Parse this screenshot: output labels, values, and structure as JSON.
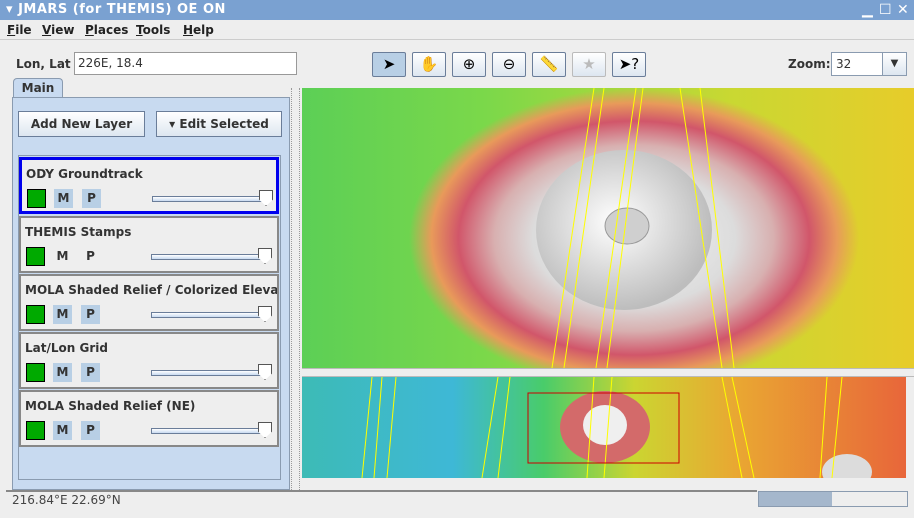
{
  "window": {
    "title": "JMARS (for THEMIS) OE ON",
    "controls": [
      "minimize",
      "maximize",
      "close"
    ]
  },
  "menu": [
    "File",
    "View",
    "Places",
    "Tools",
    "Help"
  ],
  "location": {
    "label": "Lon, Lat",
    "value": "226E, 18.4"
  },
  "toolbar": {
    "tools": [
      {
        "name": "select-arrow-icon",
        "glyph": "➤",
        "selected": true,
        "enabled": true
      },
      {
        "name": "pan-hand-icon",
        "glyph": "✋",
        "selected": false,
        "enabled": true
      },
      {
        "name": "zoom-in-icon",
        "glyph": "⊕",
        "selected": false,
        "enabled": true
      },
      {
        "name": "zoom-out-icon",
        "glyph": "⊖",
        "selected": false,
        "enabled": true
      },
      {
        "name": "ruler-icon",
        "glyph": "📏",
        "selected": false,
        "enabled": true
      },
      {
        "name": "star-icon",
        "glyph": "★",
        "selected": false,
        "enabled": false
      },
      {
        "name": "help-pointer-icon",
        "glyph": "➤?",
        "selected": false,
        "enabled": true
      }
    ]
  },
  "zoom": {
    "label": "Zoom:",
    "value": "32"
  },
  "tabs": [
    {
      "label": "Main",
      "active": true
    }
  ],
  "panel": {
    "add_layer": "Add New Layer",
    "edit_selected": "Edit Selected"
  },
  "layers": [
    {
      "name": "ODY Groundtrack",
      "selected": true,
      "m_active": true,
      "p_active": true,
      "opacity": 1.0,
      "color": "#00aa00"
    },
    {
      "name": "THEMIS Stamps",
      "selected": false,
      "m_active": false,
      "p_active": false,
      "opacity": 1.0,
      "color": "#00aa00"
    },
    {
      "name": "MOLA Shaded Relief / Colorized Elevati...",
      "selected": false,
      "m_active": true,
      "p_active": true,
      "opacity": 1.0,
      "color": "#00aa00"
    },
    {
      "name": "Lat/Lon Grid",
      "selected": false,
      "m_active": true,
      "p_active": true,
      "opacity": 1.0,
      "color": "#00aa00"
    },
    {
      "name": "MOLA Shaded Relief (NE)",
      "selected": false,
      "m_active": true,
      "p_active": true,
      "opacity": 1.0,
      "color": "#00aa00"
    }
  ],
  "status": {
    "coords": "216.84°E   22.69°N",
    "progress": 0.49
  },
  "colors": {
    "titlebar": "#7aa1d1",
    "selection": "#0000ee",
    "groundtrack": "#ffff00",
    "overview_box": "#cc0000"
  }
}
